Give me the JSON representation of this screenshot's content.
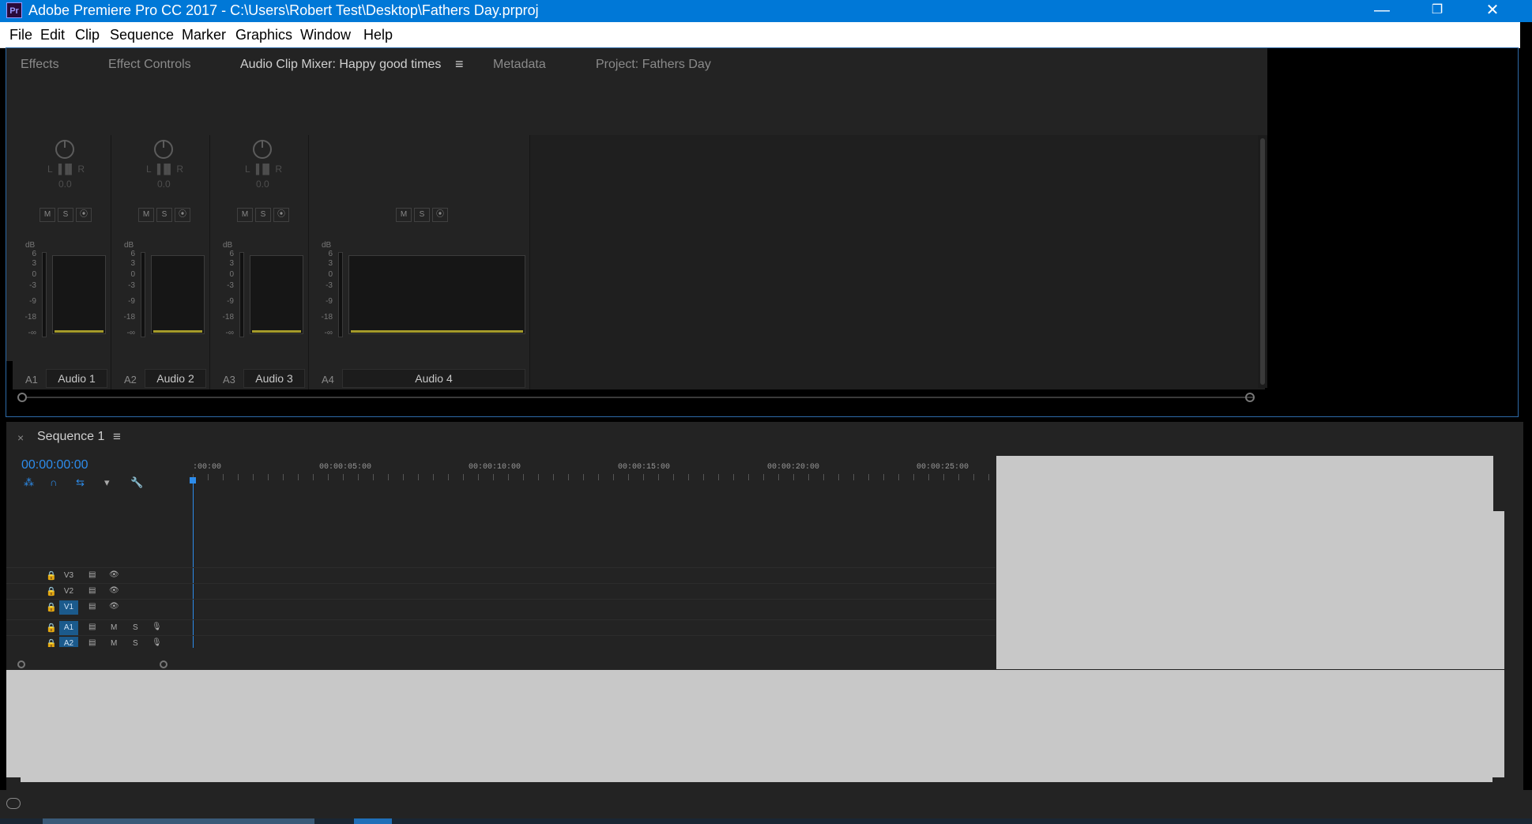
{
  "window": {
    "title": "Adobe Premiere Pro CC 2017 - C:\\Users\\Robert Test\\Desktop\\Fathers Day.prproj",
    "app_icon": "Pr",
    "minimize": "—",
    "restore": "❐",
    "close": "✕"
  },
  "menu": [
    "File",
    "Edit",
    "Clip",
    "Sequence",
    "Marker",
    "Graphics",
    "Window",
    "Help"
  ],
  "tabs": {
    "effects": "Effects",
    "effect_controls": "Effect Controls",
    "audio_clip_mixer": "Audio Clip Mixer: Happy good times",
    "panel_menu": "≡",
    "metadata": "Metadata",
    "project": "Project: Fathers Day"
  },
  "mixer": {
    "pan_lr": "L ▐▐▌ R",
    "db_unit": "dB",
    "db_ticks": [
      "6",
      "3",
      "0",
      "-3",
      "-9",
      "-18",
      "-∞"
    ],
    "buttons": {
      "mute": "M",
      "solo": "S",
      "record": "⦿"
    },
    "channels": [
      {
        "id": "A1",
        "name": "Audio 1",
        "pan": "0.0"
      },
      {
        "id": "A2",
        "name": "Audio 2",
        "pan": "0.0"
      },
      {
        "id": "A3",
        "name": "Audio 3",
        "pan": "0.0"
      },
      {
        "id": "A4",
        "name": "Audio 4"
      }
    ]
  },
  "timeline": {
    "close": "×",
    "sequence": "Sequence 1",
    "menu": "≡",
    "timecode": "00:00:00:00",
    "tools": [
      "⁂",
      "∩",
      "⇆",
      "▾",
      "🔧"
    ],
    "ruler": [
      ":00:00",
      "00:00:05:00",
      "00:00:10:00",
      "00:00:15:00",
      "00:00:20:00",
      "00:00:25:00"
    ],
    "video_tracks": [
      "V3",
      "V2",
      "V1"
    ],
    "audio_tracks": [
      "A1",
      "A2"
    ],
    "lock_icon": "🔒",
    "film_icon": "▤",
    "eye_icon": "👁",
    "mute": "M",
    "solo": "S",
    "mic_icon": "🎙"
  },
  "colors": {
    "titlebar": "#0078d7",
    "accent_blue": "#2d8ceb",
    "panel_bg": "#232323",
    "meter_base": "#a59a2a"
  }
}
